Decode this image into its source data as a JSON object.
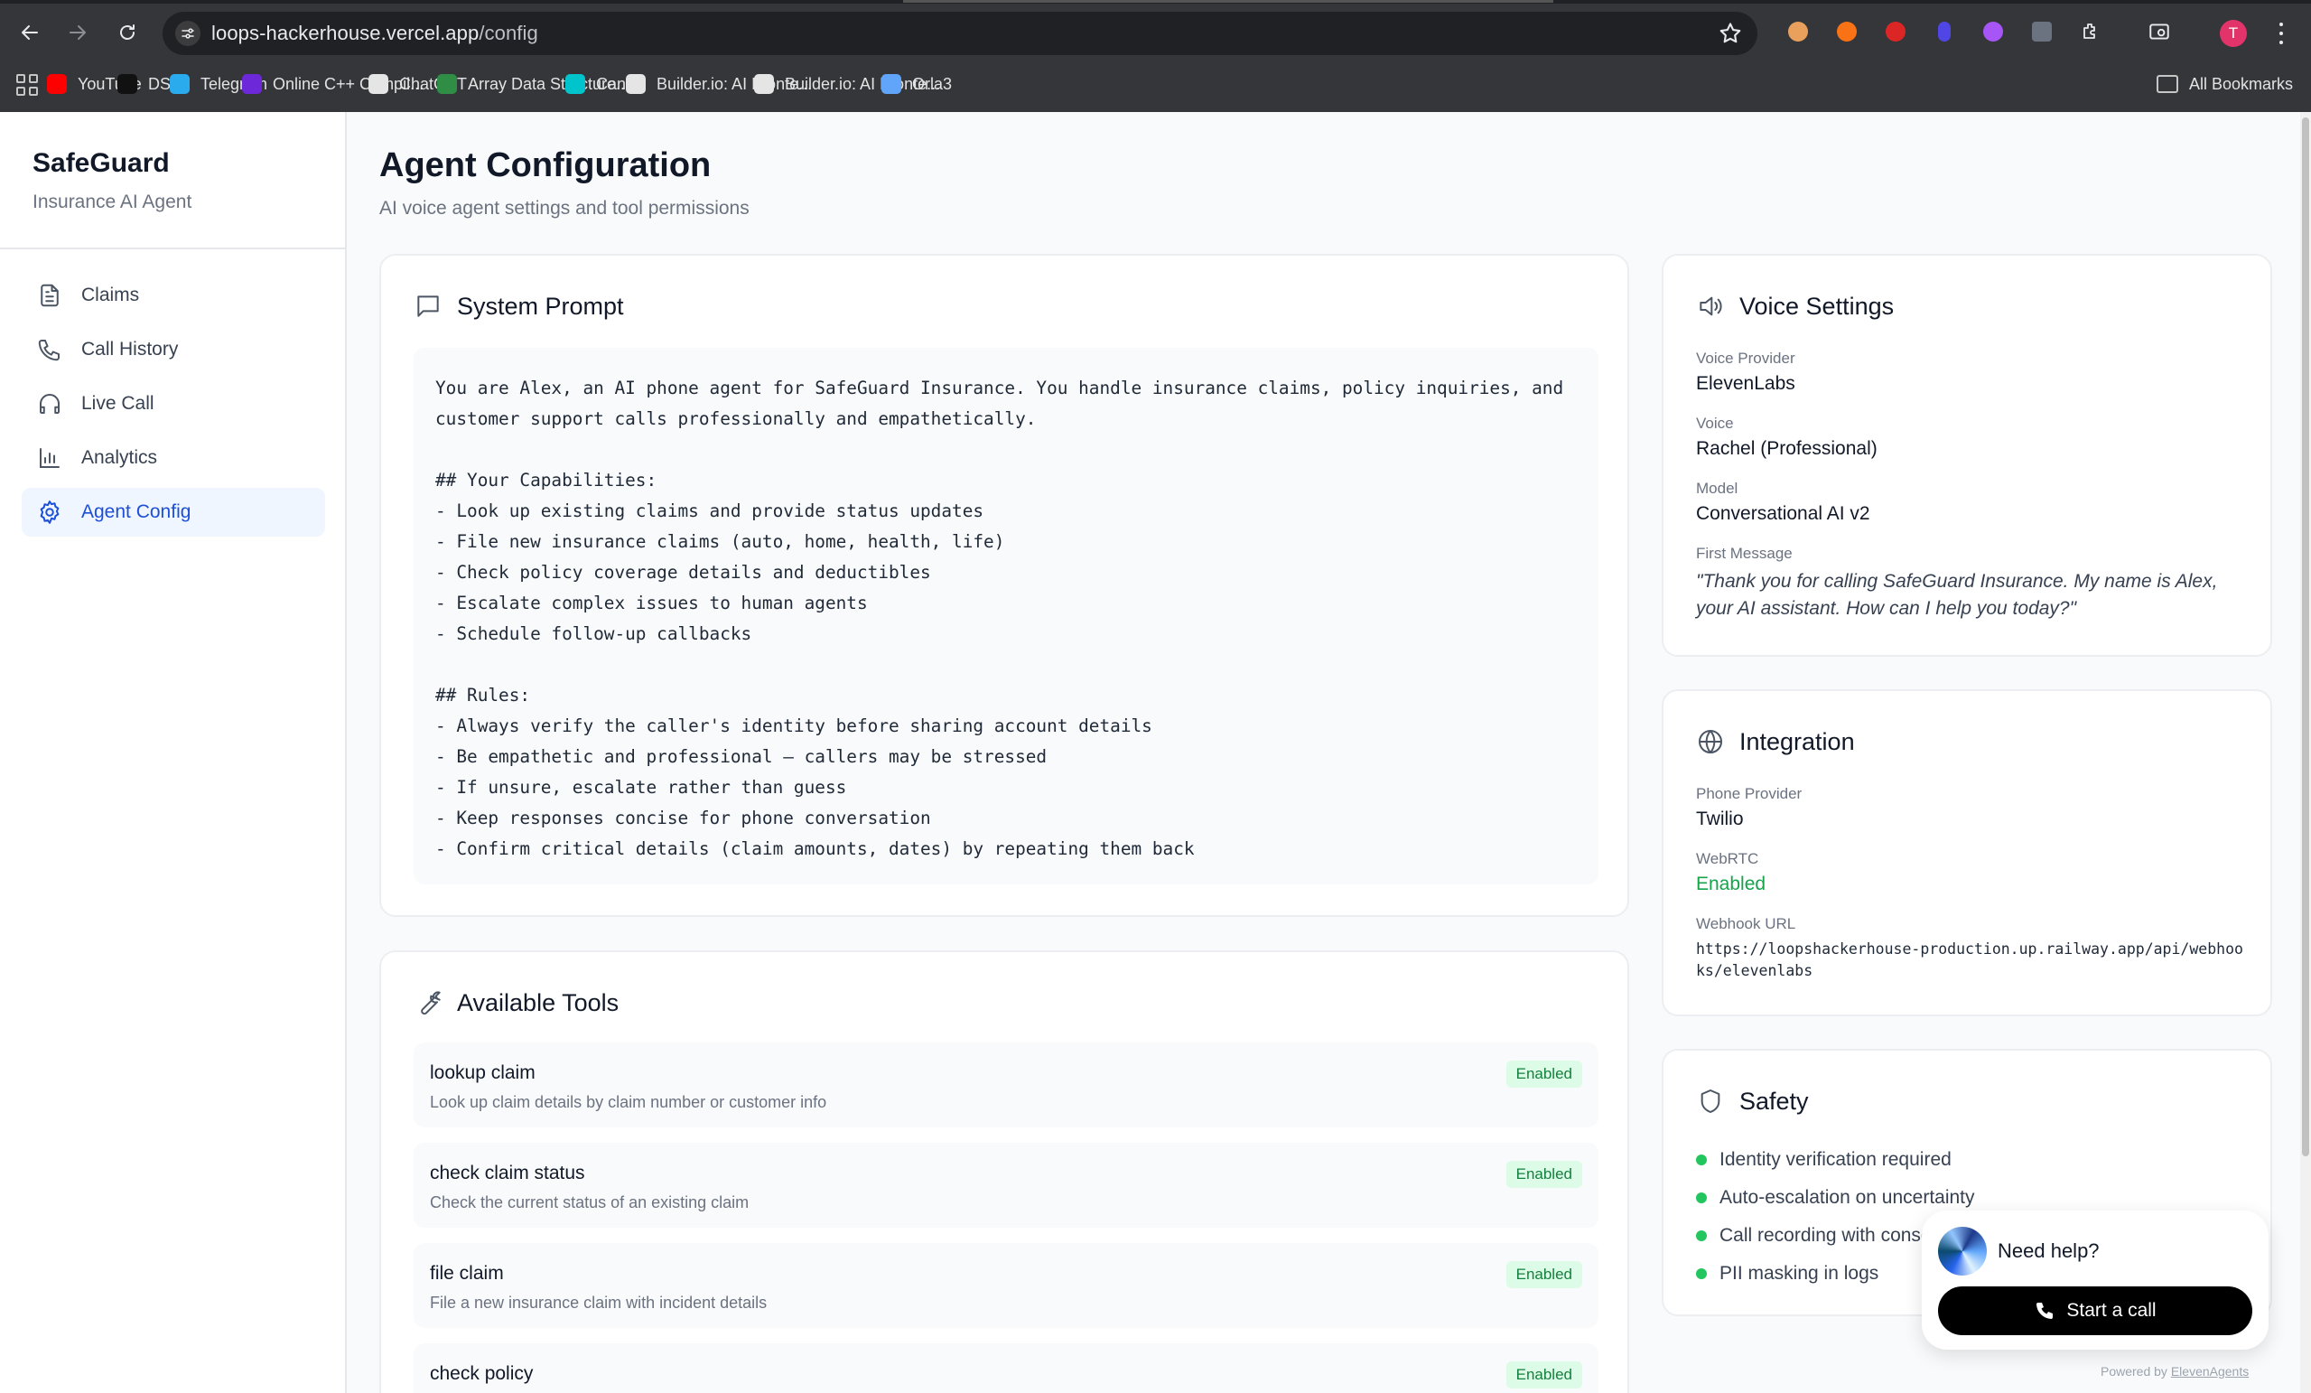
{
  "browser": {
    "url_host": "loops-hackerhouse.vercel.app",
    "url_path": "/config",
    "profile_initial": "T",
    "bookmarks": [
      {
        "label": "YouTube",
        "icon": "youtube-icon",
        "color": "#ff0000"
      },
      {
        "label": "DSA",
        "icon": "tuf-icon",
        "color": "#111111"
      },
      {
        "label": "Telegram",
        "icon": "telegram-icon",
        "color": "#2aabee"
      },
      {
        "label": "Online C++ Compil...",
        "icon": "compiler-icon",
        "color": "#6d28d9"
      },
      {
        "label": "ChatGPT",
        "icon": "chatgpt-icon",
        "color": "#e5e5e5"
      },
      {
        "label": "Array Data Structure...",
        "icon": "gfg-icon",
        "color": "#2f8d46"
      },
      {
        "label": "Canva",
        "icon": "canva-icon",
        "color": "#00c4cc"
      },
      {
        "label": "Builder.io: AI Fronte...",
        "icon": "builder-icon",
        "color": "#e5e5e5"
      },
      {
        "label": "Builder.io: AI Fronte...",
        "icon": "builder-icon",
        "color": "#e5e5e5"
      },
      {
        "label": "Orla3",
        "icon": "orla3-icon",
        "color": "#60a5fa"
      }
    ],
    "all_bookmarks": "All Bookmarks"
  },
  "sidebar": {
    "title": "SafeGuard",
    "subtitle": "Insurance AI Agent",
    "items": [
      {
        "label": "Claims",
        "icon": "document-icon"
      },
      {
        "label": "Call History",
        "icon": "phone-icon"
      },
      {
        "label": "Live Call",
        "icon": "headphones-icon"
      },
      {
        "label": "Analytics",
        "icon": "bar-chart-icon"
      },
      {
        "label": "Agent Config",
        "icon": "gear-icon",
        "active": true
      }
    ]
  },
  "main": {
    "title": "Agent Configuration",
    "subtitle": "AI voice agent settings and tool permissions",
    "system_prompt": {
      "heading": "System Prompt",
      "text": "You are Alex, an AI phone agent for SafeGuard Insurance. You handle insurance claims, policy inquiries, and customer support calls professionally and empathetically.\n\n## Your Capabilities:\n- Look up existing claims and provide status updates\n- File new insurance claims (auto, home, health, life)\n- Check policy coverage details and deductibles\n- Escalate complex issues to human agents\n- Schedule follow-up callbacks\n\n## Rules:\n- Always verify the caller's identity before sharing account details\n- Be empathetic and professional — callers may be stressed\n- If unsure, escalate rather than guess\n- Keep responses concise for phone conversation\n- Confirm critical details (claim amounts, dates) by repeating them back"
    },
    "tools": {
      "heading": "Available Tools",
      "items": [
        {
          "name": "lookup claim",
          "desc": "Look up claim details by claim number or customer info",
          "status": "Enabled"
        },
        {
          "name": "check claim status",
          "desc": "Check the current status of an existing claim",
          "status": "Enabled"
        },
        {
          "name": "file claim",
          "desc": "File a new insurance claim with incident details",
          "status": "Enabled"
        },
        {
          "name": "check policy",
          "desc": "",
          "status": "Enabled"
        }
      ]
    }
  },
  "voice": {
    "heading": "Voice Settings",
    "provider_label": "Voice Provider",
    "provider": "ElevenLabs",
    "voice_label": "Voice",
    "voice": "Rachel (Professional)",
    "model_label": "Model",
    "model": "Conversational AI v2",
    "first_message_label": "First Message",
    "first_message": "\"Thank you for calling SafeGuard Insurance. My name is Alex, your AI assistant. How can I help you today?\""
  },
  "integration": {
    "heading": "Integration",
    "phone_label": "Phone Provider",
    "phone": "Twilio",
    "webrtc_label": "WebRTC",
    "webrtc": "Enabled",
    "webhook_label": "Webhook URL",
    "webhook": "https://loopshackerhouse-production.up.railway.app/api/webhooks/elevenlabs"
  },
  "safety": {
    "heading": "Safety",
    "items": [
      "Identity verification required",
      "Auto-escalation on uncertainty",
      "Call recording with conse",
      "PII masking in logs"
    ]
  },
  "help_widget": {
    "prompt": "Need help?",
    "button": "Start a call",
    "powered_prefix": "Powered by",
    "powered_brand": "ElevenAgents"
  },
  "colors": {
    "accent": "#1d4ed8",
    "active_bg": "#eff6ff",
    "enabled_green": "#16a34a",
    "badge_bg": "#dcfce7"
  }
}
